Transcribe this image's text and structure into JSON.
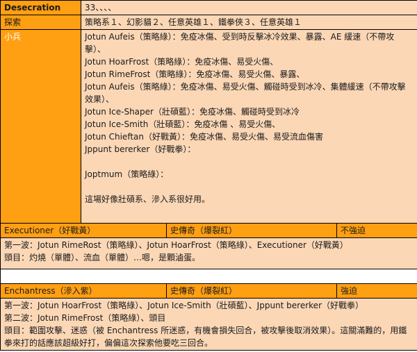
{
  "header": {
    "title": "Desecration",
    "value": "33、、、、"
  },
  "explore": {
    "label": "探索",
    "value": "策略系１、幻影貓２、任意英雄１、鐵拳俠３、任意英雄１"
  },
  "minions": {
    "label": "小兵",
    "lines": [
      "Jotun Aufeis（策略綠）：免疫冰傷、受到時反擊冰冷效果、暴露、AE 緩速（不帶攻擊）、",
      "Jotun HoarFrost（策略綠）：免疫冰傷、易受火傷、",
      "Jotun RimeFrost（策略綠）：免疫冰傷、易受火傷、暴露、",
      "Jotun Aufeis（策略綠）：免疫冰傷、易受火傷、觸碰時受到冰冷、集體緩速（不帶攻擊效果）、",
      "Jotun Ice-Shaper（壯碩藍）：免疫冰傷、觸碰時受到冰冷",
      "Jotun Ice-Smith（壯碩藍）：免疫冰傷 、易受火傷、",
      "Jotun Chieftan（好戰黃）：免疫冰傷、易受火傷、易受流血傷害",
      "Jppunt bererker（好戰拳）：",
      "",
      "Joptmum（策略綠）：",
      "",
      "這場好像壯碩系、滲入系很好用。"
    ]
  },
  "executioner": {
    "name": "Executioner（好戰黃）",
    "rarity": "史傳奇（爆裂紅）",
    "difficulty": "不強迫",
    "lines": [
      "第一波：Jotun RimeRost（策略綠）、Jotun HoarFrost（策略綠）、Executioner（好戰黃）",
      "頭目：灼燒（單體）、流血（單體）…嗯，是顆滷蛋。"
    ]
  },
  "enchantress": {
    "name": "Enchantress（滲入紫）",
    "rarity": "史傳奇（爆裂紅）",
    "difficulty": "強迫",
    "lines": [
      "第一波：Jotun HoarFrost（策略綠）、Jotun Ice-Smith（壯碩藍）、Jppunt bererker（好戰拳）",
      "第二波：Jotun RimeFrost（策略綠）、頭目",
      "頭目：範圍攻擊、迷惑（被 Enchantress 所迷惑，有機會損失回合，被攻擊後取消效果）。這關滿難的，用鐵拳來打的話應該超級好打，偏偏這次探索他要吃三回合。"
    ]
  }
}
